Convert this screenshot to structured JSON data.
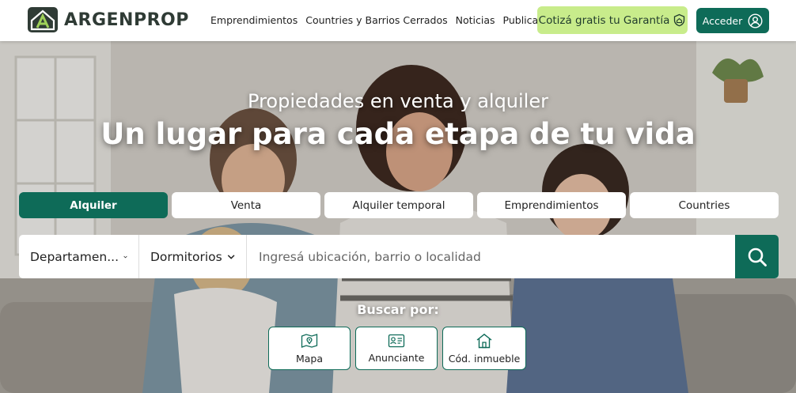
{
  "brand": {
    "name": "ARGENPROP",
    "logo_icon": "house-a-icon"
  },
  "nav": {
    "items": [
      {
        "label": "Emprendimientos"
      },
      {
        "label": "Countries y Barrios Cerrados"
      },
      {
        "label": "Noticias"
      },
      {
        "label": "Publicar"
      }
    ],
    "garantia": {
      "label": "Cotizá gratis tu Garantía",
      "icon": "shield-house-icon"
    },
    "login": {
      "label": "Acceder",
      "icon": "user-circle-icon"
    }
  },
  "hero": {
    "subtitle": "Propiedades en venta y alquiler",
    "title": "Un lugar para cada etapa de tu vida"
  },
  "tabs": [
    {
      "label": "Alquiler",
      "active": true
    },
    {
      "label": "Venta",
      "active": false
    },
    {
      "label": "Alquiler temporal",
      "active": false
    },
    {
      "label": "Emprendimientos",
      "active": false
    },
    {
      "label": "Countries",
      "active": false
    }
  ],
  "search": {
    "tipo": "Departamen...",
    "dormitorios": "Dormitorios",
    "placeholder": "Ingresá ubicación, barrio o localidad",
    "button_icon": "search-icon"
  },
  "buscar_por": {
    "label": "Buscar por:",
    "options": [
      {
        "label": "Mapa",
        "icon": "map-pin-icon"
      },
      {
        "label": "Anunciante",
        "icon": "id-card-icon"
      },
      {
        "label": "Cód. inmueble",
        "icon": "home-icon"
      }
    ]
  },
  "colors": {
    "primary": "#0e6b58",
    "accent": "#c8ec8b",
    "text": "#222222"
  }
}
